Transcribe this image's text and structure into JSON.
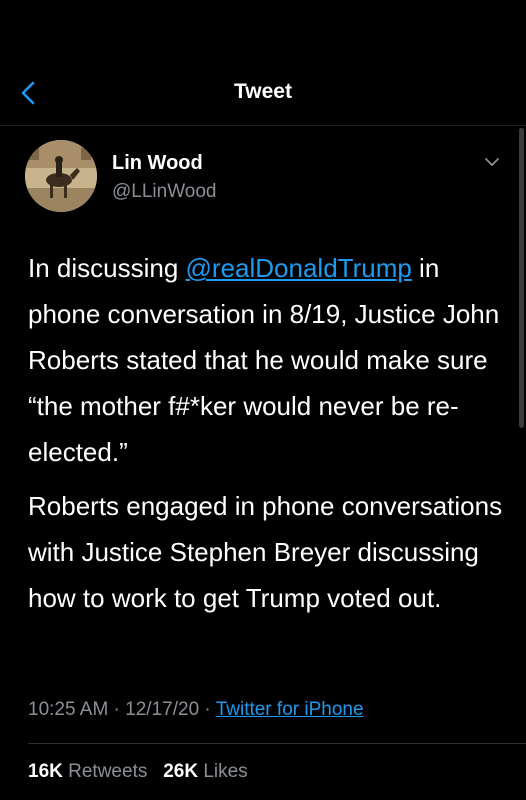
{
  "header": {
    "title": "Tweet",
    "back_icon": "chevron-left-icon"
  },
  "author": {
    "display_name": "Lin Wood",
    "handle": "@LLinWood",
    "menu_icon": "chevron-down-icon"
  },
  "tweet": {
    "p1_prefix": "In discussing ",
    "p1_mention": "@realDonaldTrump",
    "p1_rest": " in phone conversation in 8/19, Justice John Roberts stated that he would make sure “the mother f#*ker would never be re-elected.”",
    "p2": "Roberts engaged in phone conversations with Justice Stephen Breyer discussing how to work to get Trump voted out."
  },
  "meta": {
    "time": "10:25 AM",
    "sep1": " · ",
    "date": "12/17/20",
    "sep2": " · ",
    "source": "Twitter for iPhone"
  },
  "stats": {
    "retweets_count": "16K",
    "retweets_label": "Retweets",
    "likes_count": "26K",
    "likes_label": "Likes"
  },
  "colors": {
    "background": "#000000",
    "accent": "#1d9bf0",
    "secondary_text": "#8b9097"
  }
}
